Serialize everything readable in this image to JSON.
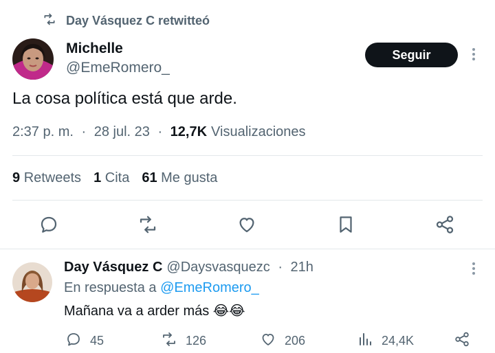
{
  "retweet_header": {
    "icon": "retweet-icon",
    "text": "Day Vásquez C retwitteó"
  },
  "tweet": {
    "author_name": "Michelle",
    "author_handle": "@EmeRomero_",
    "follow_label": "Seguir",
    "text": "La cosa política está que arde.",
    "time": "2:37 p. m.",
    "sep1": " · ",
    "date": "28 jul. 23",
    "sep2": " · ",
    "views_count": "12,7K",
    "views_label": "Visualizaciones",
    "stats": {
      "retweets_count": "9",
      "retweets_label": "Retweets",
      "quotes_count": "1",
      "quotes_label": "Cita",
      "likes_count": "61",
      "likes_label": "Me gusta"
    },
    "actions": [
      "reply-icon",
      "retweet-icon",
      "like-icon",
      "bookmark-icon",
      "share-icon"
    ]
  },
  "reply": {
    "author_name": "Day Vásquez C",
    "author_handle": "@Daysvasquezc",
    "sep": " · ",
    "time": "21h",
    "reply_prefix": "En respuesta a ",
    "reply_to_handle": "@EmeRomero_",
    "text": "Mañana va a arder más 😂😂",
    "replies": "45",
    "retweets": "126",
    "likes": "206",
    "views": "24,4K"
  },
  "colors": {
    "text": "#0f1419",
    "muted": "#536471",
    "link": "#1d9bf0",
    "divider": "#e3e7ea",
    "button": "#0f1419"
  }
}
